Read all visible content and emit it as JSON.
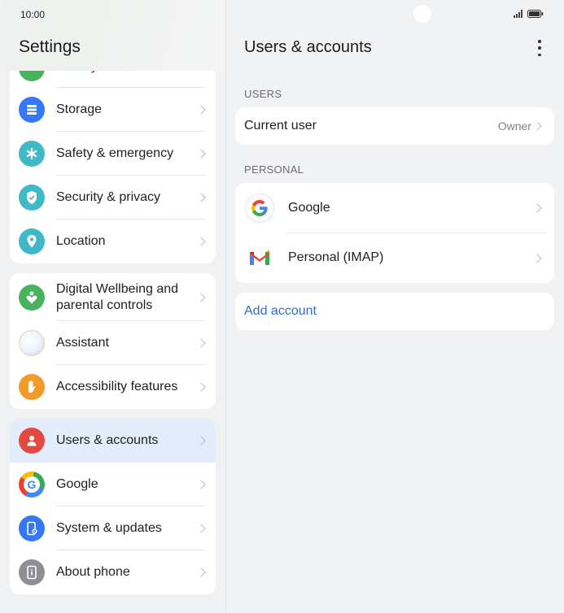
{
  "status_bar": {
    "time": "10:00"
  },
  "left_pane": {
    "title": "Settings",
    "partial_item": "Battery",
    "group1": [
      {
        "label": "Storage",
        "icon": "storage-icon",
        "color": "#3478f6"
      },
      {
        "label": "Safety & emergency",
        "icon": "asterisk-icon",
        "color": "#3fb8c8"
      },
      {
        "label": "Security & privacy",
        "icon": "shield-icon",
        "color": "#3fb8c8"
      },
      {
        "label": "Location",
        "icon": "location-pin-icon",
        "color": "#3fb8c8"
      }
    ],
    "group2": [
      {
        "label": "Digital Wellbeing and parental controls",
        "icon": "heart-person-icon",
        "color": "#49b25c"
      },
      {
        "label": "Assistant",
        "icon": "assistant-orb-icon",
        "color": "#d9dde6"
      },
      {
        "label": "Accessibility features",
        "icon": "hand-icon",
        "color": "#f29b2b"
      }
    ],
    "group3": [
      {
        "label": "Users & accounts",
        "icon": "user-icon",
        "color": "#e24a3f",
        "selected": true
      },
      {
        "label": "Google",
        "icon": "google-icon",
        "color": "#ffffff"
      },
      {
        "label": "System & updates",
        "icon": "phone-gear-icon",
        "color": "#3478f6"
      },
      {
        "label": "About phone",
        "icon": "info-phone-icon",
        "color": "#8e8e93"
      }
    ]
  },
  "right_pane": {
    "title": "Users & accounts",
    "users_section": "USERS",
    "current_user_label": "Current user",
    "current_user_value": "Owner",
    "personal_section": "PERSONAL",
    "accounts": [
      {
        "label": "Google",
        "icon": "google-icon"
      },
      {
        "label": "Personal (IMAP)",
        "icon": "gmail-icon"
      }
    ],
    "add_account": "Add account"
  }
}
